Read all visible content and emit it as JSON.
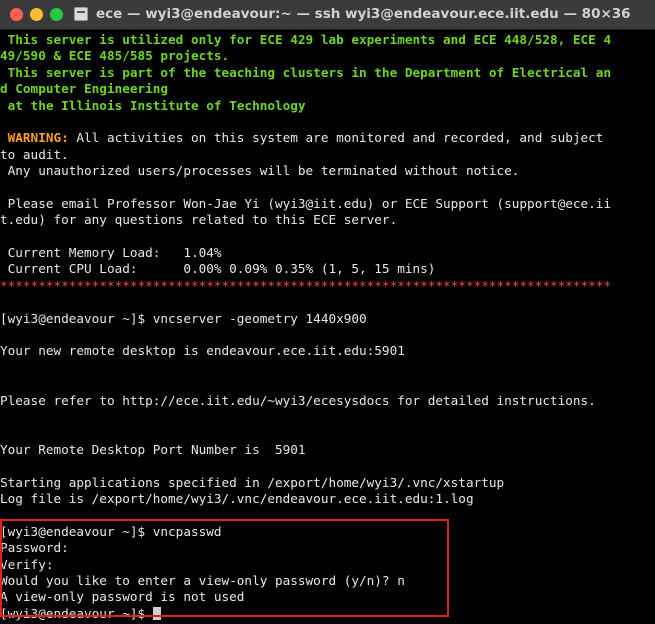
{
  "window": {
    "title": "ece — wyi3@endeavour:~ — ssh wyi3@endeavour.ece.iit.edu — 80×36",
    "icon": "terminal-icon"
  },
  "colors": {
    "banner_green": "#6fd61f",
    "warning_orange": "#ff9e1f",
    "separator_red": "#ff4a2e",
    "highlight_box": "#e0221a"
  },
  "banner": {
    "line1": " This server is utilized only for ECE 429 lab experiments and ECE 448/528, ECE 4",
    "line2": "49/590 & ECE 485/585 projects.",
    "line3": " This server is part of the teaching clusters in the Department of Electrical an",
    "line4": "d Computer Engineering",
    "line5": " at the Illinois Institute of Technology"
  },
  "warning": {
    "label": " WARNING:",
    "text1": " All activities on this system are monitored and recorded, and subject",
    "text2": "to audit.",
    "text3": " Any unauthorized users/processes will be terminated without notice."
  },
  "contact": {
    "line1": " Please email Professor Won-Jae Yi (wyi3@iit.edu) or ECE Support (support@ece.ii",
    "line2": "t.edu) for any questions related to this ECE server."
  },
  "load": {
    "memory": " Current Memory Load:   1.04%",
    "cpu": " Current CPU Load:      0.00% 0.09% 0.35% (1, 5, 15 mins)"
  },
  "separator": "********************************************************************************",
  "session": {
    "cmd1": "[wyi3@endeavour ~]$ vncserver -geometry 1440x900",
    "out1": "Your new remote desktop is endeavour.ece.iit.edu:5901",
    "out2": "Please refer to http://ece.iit.edu/~wyi3/ecesysdocs for detailed instructions.",
    "out3": "Your Remote Desktop Port Number is  5901",
    "out4": "Starting applications specified in /export/home/wyi3/.vnc/xstartup",
    "out5": "Log file is /export/home/wyi3/.vnc/endeavour.ece.iit.edu:1.log",
    "cmd2": "[wyi3@endeavour ~]$ vncpasswd",
    "out6": "Password:",
    "out7": "Verify:",
    "out8": "Would you like to enter a view-only password (y/n)? n",
    "out9": "A view-only password is not used",
    "prompt": "[wyi3@endeavour ~]$ "
  }
}
